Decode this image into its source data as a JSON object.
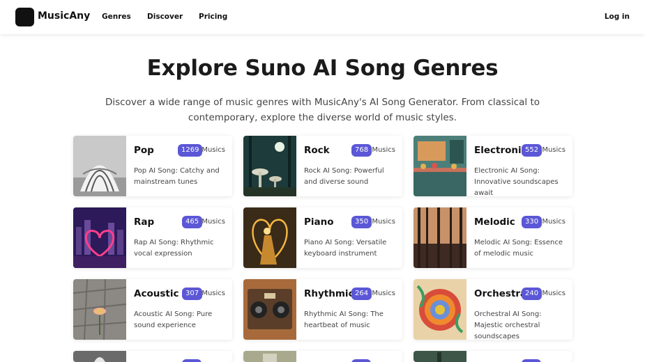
{
  "header": {
    "brand": "MusicAny",
    "nav": [
      "Genres",
      "Discover",
      "Pricing"
    ],
    "login": "Log in"
  },
  "hero": {
    "title": "Explore Suno AI Song Genres",
    "subtitle": "Discover a wide range of music genres with MusicAny's AI Song Generator. From classical to contemporary, explore the diverse world of music styles."
  },
  "colors": {
    "accent": "#5b57d6"
  },
  "genres": [
    {
      "name": "Pop",
      "count": "1269",
      "unit": "Musics",
      "desc": "Pop AI Song: Catchy and mainstream tunes"
    },
    {
      "name": "Rock",
      "count": "768",
      "unit": "Musics",
      "desc": "Rock AI Song: Powerful and diverse sound"
    },
    {
      "name": "Electronic",
      "count": "552",
      "unit": "Musics",
      "desc": "Electronic AI Song: Innovative soundscapes await"
    },
    {
      "name": "Rap",
      "count": "465",
      "unit": "Musics",
      "desc": "Rap AI Song: Rhythmic vocal expression"
    },
    {
      "name": "Piano",
      "count": "350",
      "unit": "Musics",
      "desc": "Piano AI Song: Versatile keyboard instrument"
    },
    {
      "name": "Melodic",
      "count": "330",
      "unit": "Musics",
      "desc": "Melodic AI Song: Essence of melodic music"
    },
    {
      "name": "Acoustic",
      "count": "307",
      "unit": "Musics",
      "desc": "Acoustic AI Song: Pure sound experience"
    },
    {
      "name": "Rhythmic",
      "count": "264",
      "unit": "Musics",
      "desc": "Rhythmic AI Song: The heartbeat of music"
    },
    {
      "name": "Orchestral",
      "count": "240",
      "unit": "Musics",
      "desc": "Orchestral AI Song: Majestic orchestral soundscapes"
    }
  ]
}
